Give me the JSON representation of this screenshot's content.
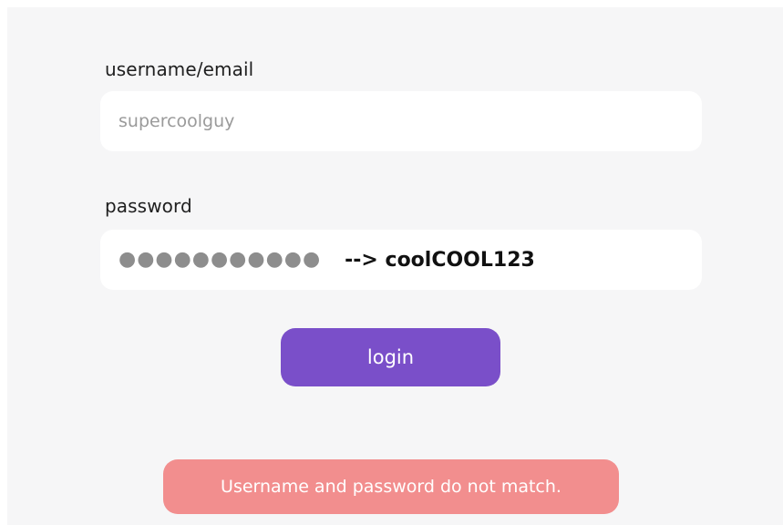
{
  "form": {
    "username": {
      "label": "username/email",
      "placeholder": "supercoolguy",
      "value": ""
    },
    "password": {
      "label": "password",
      "masked_value": "●●●●●●●●●●●",
      "annotation": "--> coolCOOL123"
    },
    "login_button": "login",
    "error_message": "Username and password do not match."
  },
  "colors": {
    "panel_bg": "#f6f6f7",
    "button_bg": "#7a4fc9",
    "error_bg": "#f28e8e"
  }
}
